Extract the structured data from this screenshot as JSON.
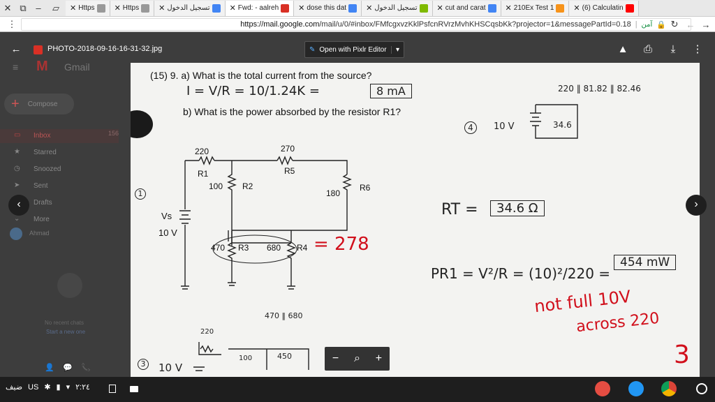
{
  "tabs": [
    {
      "title": "Https",
      "icon": "window-icon",
      "fav_color": "#999999"
    },
    {
      "title": "Https",
      "icon": "window-icon",
      "fav_color": "#999999"
    },
    {
      "title": "تسجيل الدخول",
      "icon": "google-g-icon",
      "fav_color": "#4285f4"
    },
    {
      "title": "Fwd: - aalreh",
      "icon": "gmail-icon",
      "fav_color": "#d93025"
    },
    {
      "title": "dose this dat",
      "icon": "google-g-icon",
      "fav_color": "#4285f4"
    },
    {
      "title": "تسجيل الدخول",
      "icon": "microsoft-icon",
      "fav_color": "#7fba00"
    },
    {
      "title": "cut and carat",
      "icon": "google-g-icon",
      "fav_color": "#4285f4"
    },
    {
      "title": "210Ex Test 1",
      "icon": "bitcoin-icon",
      "fav_color": "#f7931a"
    },
    {
      "title": "(6) Calculatin",
      "icon": "youtube-icon",
      "fav_color": "#ff0000"
    }
  ],
  "address": {
    "scheme_host": "https://mail.google.com",
    "path": "/mail/u/0/#inbox/FMfcgxvzKklPsfcnRVrzMvhKHSCqsbKk?projector=1&messagePartId=0.18",
    "secure_label": "آمن"
  },
  "gmail": {
    "logo": "Gmail",
    "compose": "Compose",
    "nav": [
      "Inbox",
      "Starred",
      "Snoozed",
      "Sent",
      "Drafts",
      "More"
    ],
    "inbox_count": "156",
    "user": "Ahmad",
    "no_chats": "No recent chats",
    "start_chat": "Start a new one"
  },
  "viewer": {
    "title": "PHOTO-2018-09-16-16-31-32.jpg",
    "pixlr_label": "Open with Pixlr Editor",
    "accent": "#d93025"
  },
  "photo": {
    "question": "(15)  9. a) What is the total current from the source?",
    "eq1": "I = V/R = 10/1.24K = ",
    "eq1_box": "8 mA",
    "q2": "b) What is the power absorbed by the resistor R1?",
    "topright": "220 ‖ 81.82 ‖ 82.46",
    "src_note_num": "4",
    "src_note": "10 V",
    "src_value": "34.6",
    "r1_val": "220",
    "r1_lbl": "R1",
    "r5_val": "270",
    "r5_lbl": "R5",
    "r2_val": "100",
    "r2_lbl": "R2",
    "r6_val": "180",
    "r6_lbl": "R6",
    "vs_lbl": "Vs",
    "vs_val": "10 V",
    "r3_val": "470",
    "r3_lbl": "R3",
    "r4_val": "680",
    "r4_lbl": "R4",
    "r34_note": "= 278",
    "circle1": "1",
    "rt_eq": "RT =",
    "rt_box": "34.6 Ω",
    "pr_eq": "PR1 = V²/R = (10)²/220 =",
    "pr_box": "454 mW",
    "notfull": "not full 10V",
    "across": "across 220",
    "par_note": "470 ‖ 680",
    "bottom_a": "220",
    "bottom_b": "100",
    "bottom_c": "450",
    "circle3": "3",
    "bottom_v": "10 V",
    "three": "3"
  },
  "shelf": {
    "time": "٢:٢٤",
    "locale": "US",
    "day": "ضيف"
  }
}
